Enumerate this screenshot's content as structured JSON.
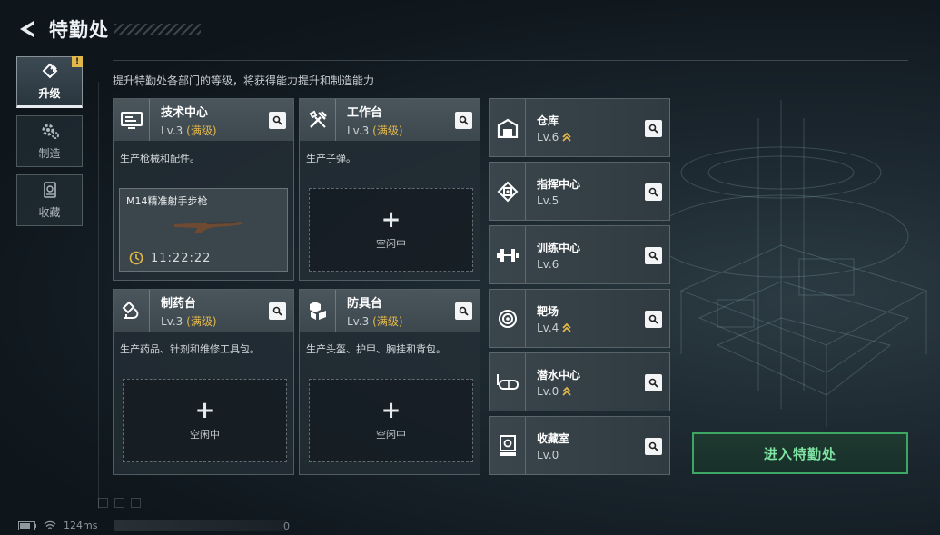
{
  "header": {
    "title": "特勤处",
    "description": "提升特勤处各部门的等级，将获得能力提升和制造能力"
  },
  "sidebar": [
    {
      "label": "升级",
      "icon": "upgrade-icon",
      "active": true,
      "badge": "!"
    },
    {
      "label": "制造",
      "icon": "gear-icon",
      "active": false
    },
    {
      "label": "收藏",
      "icon": "collection-icon",
      "active": false
    }
  ],
  "departments": [
    {
      "name": "技术中心",
      "level": "Lv.3",
      "max": "(满级)",
      "desc": "生产枪械和配件。",
      "icon": "tech-center-icon",
      "production": {
        "item": "M14精准射手步枪",
        "timer": "11:22:22"
      }
    },
    {
      "name": "工作台",
      "level": "Lv.3",
      "max": "(满级)",
      "desc": "生产子弹。",
      "icon": "workbench-icon",
      "slot": {
        "plus": "+",
        "status": "空闲中"
      }
    },
    {
      "name": "制药台",
      "level": "Lv.3",
      "max": "(满级)",
      "desc": "生产药品、针剂和维修工具包。",
      "icon": "pharmacy-icon",
      "slot": {
        "plus": "+",
        "status": "空闲中"
      }
    },
    {
      "name": "防具台",
      "level": "Lv.3",
      "max": "(满级)",
      "desc": "生产头盔、护甲、胸挂和背包。",
      "icon": "armor-bench-icon",
      "slot": {
        "plus": "+",
        "status": "空闲中"
      }
    }
  ],
  "facilities": [
    {
      "name": "仓库",
      "level": "Lv.6",
      "upgradable": true,
      "icon": "warehouse-icon"
    },
    {
      "name": "指挥中心",
      "level": "Lv.5",
      "upgradable": false,
      "icon": "command-center-icon"
    },
    {
      "name": "训练中心",
      "level": "Lv.6",
      "upgradable": false,
      "icon": "training-center-icon"
    },
    {
      "name": "靶场",
      "level": "Lv.4",
      "upgradable": true,
      "icon": "shooting-range-icon"
    },
    {
      "name": "潜水中心",
      "level": "Lv.0",
      "upgradable": true,
      "icon": "diving-center-icon"
    },
    {
      "name": "收藏室",
      "level": "Lv.0",
      "upgradable": false,
      "icon": "collection-room-icon"
    }
  ],
  "enter_button": "进入特勤处",
  "status_bar": {
    "ping": "124ms",
    "counter": "0"
  },
  "colors": {
    "accent_gold": "#e3b84a",
    "enter_green": "#7ee2a0",
    "enter_border": "#3ea663"
  }
}
